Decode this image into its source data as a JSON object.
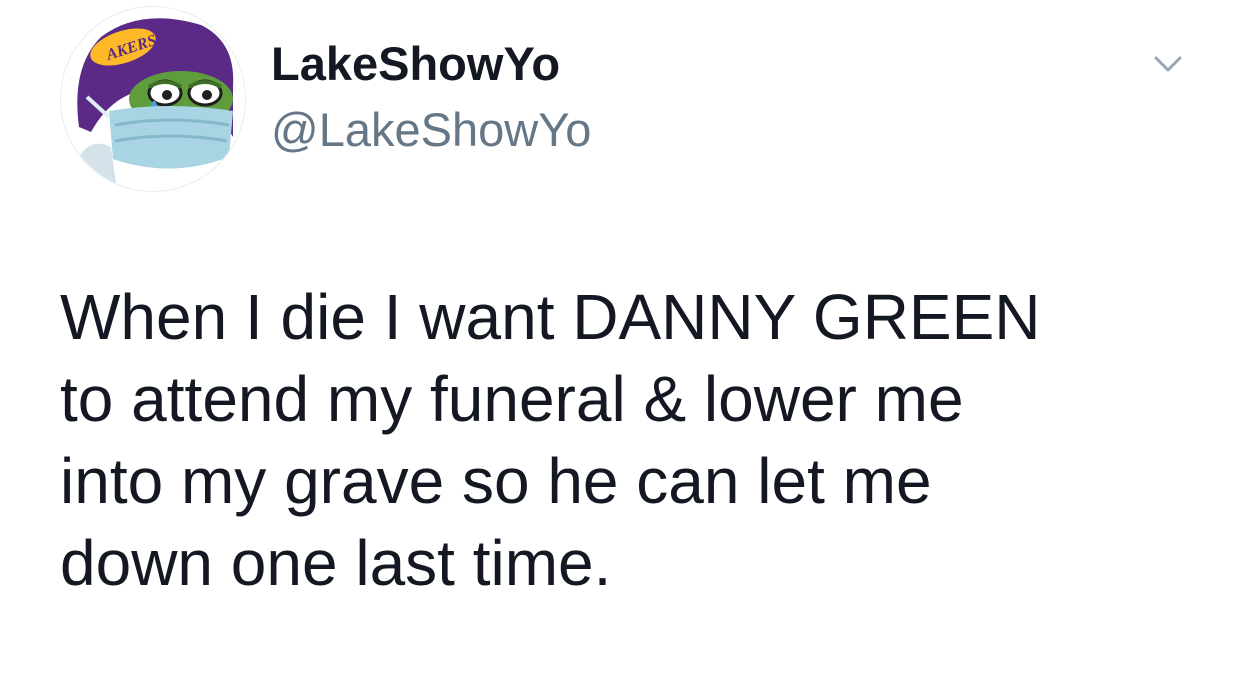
{
  "tweet": {
    "display_name": "LakeShowYo",
    "handle": "@LakeShowYo",
    "avatar": {
      "description_icon": "pepe-frog-lakers-mask-avatar",
      "logo_text": "AKERS",
      "colors": {
        "purple": "#5b2a86",
        "gold": "#fdb927",
        "mask": "#a9d4e3",
        "frog": "#5f9c3c"
      }
    },
    "menu_icon": "chevron-down-icon",
    "text_lines": [
      "When I die I want DANNY GREEN",
      "to attend my funeral & lower me",
      "into my grave so he can let me",
      "down one last time."
    ]
  }
}
